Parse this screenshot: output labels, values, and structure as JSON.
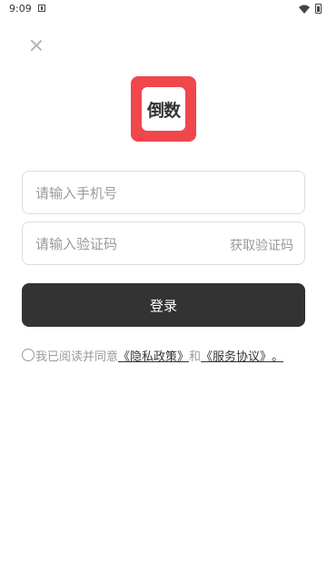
{
  "status_bar": {
    "time": "9:09"
  },
  "logo": {
    "text": "倒数",
    "background_color": "#f0474c"
  },
  "phone_input": {
    "placeholder": "请输入手机号",
    "value": ""
  },
  "code_input": {
    "placeholder": "请输入验证码",
    "value": ""
  },
  "get_code_label": "获取验证码",
  "login_label": "登录",
  "agreement": {
    "prefix": "我已阅读并同意",
    "privacy_link": "《隐私政策》",
    "connector": "和",
    "service_link": "《服务协议》",
    "suffix": "。"
  },
  "colors": {
    "primary_button": "#333333",
    "placeholder": "#9a9a9a",
    "border": "#dcdcdc"
  }
}
